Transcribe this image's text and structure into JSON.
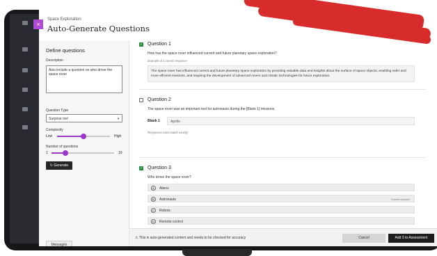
{
  "header": {
    "eyebrow": "Space Exploration",
    "title": "Auto-Generate Questions",
    "close_icon": "×"
  },
  "left": {
    "heading": "Define questions",
    "description_label": "Description",
    "description_value": "Also include a question on who drove the space rover",
    "question_type_label": "Question Type",
    "question_type_value": "Surprise me!",
    "complexity_label": "Complexity",
    "complexity_low": "Low",
    "complexity_high": "High",
    "complexity_level": 0.5,
    "num_questions_label": "Number of questions",
    "num_min": "1",
    "num_max": "10",
    "num_value": 3,
    "generate_label": "Generate",
    "messages_label": "Messages"
  },
  "questions": [
    {
      "title": "Question 1",
      "checked": true,
      "text": "How has the space rover influenced current and future planetary space exploration?",
      "note": "Example of a correct response",
      "response": "The space rover has influenced current and future planetary space exploration by providing valuable data and insights about the surface of space objects, enabling safer and more efficient missions, and inspiring the development of advanced rovers and robotic technologies for future exploration."
    },
    {
      "title": "Question 2",
      "checked": false,
      "text": "The space rover was an important tool for astronauts during the [Blank 1] missions.",
      "blank_label": "Blank 1",
      "blank_value": "Apollo",
      "note": "Responses must match exactly"
    },
    {
      "title": "Question 3",
      "checked": true,
      "text": "Who drove the space rover?",
      "options": [
        {
          "letter": "A",
          "text": "Aliens",
          "correct": ""
        },
        {
          "letter": "B",
          "text": "Astronauts",
          "correct": "Correct answer"
        },
        {
          "letter": "C",
          "text": "Robots",
          "correct": ""
        },
        {
          "letter": "D",
          "text": "Remote control",
          "correct": ""
        }
      ]
    }
  ],
  "footer": {
    "warning": "This is auto-generated content and needs to be checked for accuracy",
    "cancel_label": "Cancel",
    "add_label": "Add 3 to Assessment"
  },
  "colors": {
    "accent": "#9a37c8",
    "check": "#2a8a3c",
    "paint": "#d82c2c"
  }
}
